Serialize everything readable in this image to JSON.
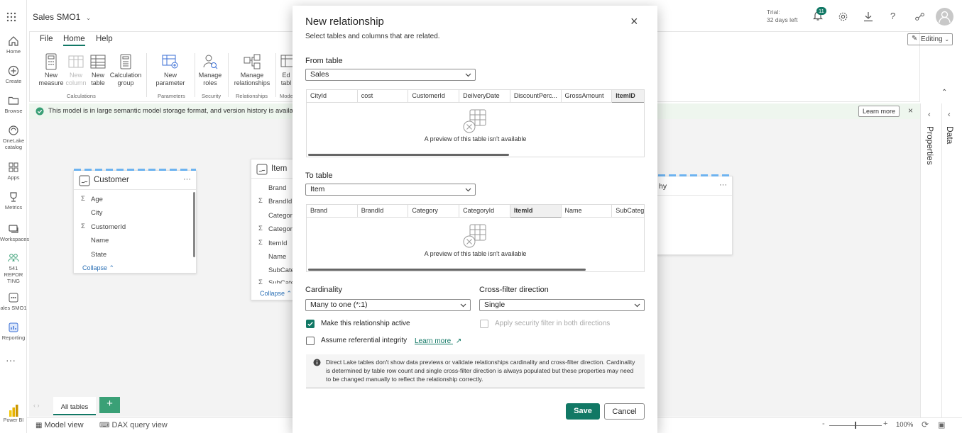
{
  "app": {
    "title": "Sales SMO1",
    "trial_line1": "Trial:",
    "trial_line2": "32 days left",
    "notification_count": "11",
    "editing_label": "Editing"
  },
  "rail": [
    {
      "label": "Home",
      "icon": "home-icon"
    },
    {
      "label": "Create",
      "icon": "plus-circle-icon"
    },
    {
      "label": "Browse",
      "icon": "folder-icon"
    },
    {
      "label": "OneLake catalog",
      "icon": "onelake-icon"
    },
    {
      "label": "Apps",
      "icon": "apps-icon"
    },
    {
      "label": "Metrics",
      "icon": "trophy-icon"
    },
    {
      "label": "Workspaces",
      "icon": "workspaces-icon"
    },
    {
      "label": "541 REPOR TING",
      "icon": "people-icon"
    },
    {
      "label": "ales SMO1",
      "icon": "semantic-model-icon"
    },
    {
      "label": "Reporting",
      "icon": "report-icon"
    }
  ],
  "ribbon": {
    "tabs": [
      "File",
      "Home",
      "Help"
    ],
    "active_tab": "Home",
    "buttons": {
      "new_measure": "New measure",
      "new_column": "New column",
      "new_table": "New table",
      "calc_group": "Calculation group",
      "new_parameter": "New parameter",
      "manage_roles": "Manage roles",
      "manage_relationships": "Manage relationships",
      "edit_tables": "Ed tabl"
    },
    "groups": {
      "calculations": "Calculations",
      "parameters": "Parameters",
      "security": "Security",
      "relationships": "Relationships",
      "model": "Mode"
    }
  },
  "infobar": {
    "message": "This model is in large semantic model storage format, and version history is available.",
    "learn_more": "Learn more"
  },
  "canvas": {
    "customer": {
      "title": "Customer",
      "fields": [
        {
          "name": "Age",
          "sigma": "Σ"
        },
        {
          "name": "City",
          "sigma": ""
        },
        {
          "name": "CustomerId",
          "sigma": "Σ"
        },
        {
          "name": "Name",
          "sigma": ""
        },
        {
          "name": "State",
          "sigma": ""
        }
      ],
      "collapse": "Collapse"
    },
    "item": {
      "title": "Item",
      "fields": [
        {
          "name": "Brand",
          "sigma": ""
        },
        {
          "name": "BrandId",
          "sigma": "Σ"
        },
        {
          "name": "Category",
          "sigma": ""
        },
        {
          "name": "CategoryId",
          "sigma": "Σ"
        },
        {
          "name": "ItemId",
          "sigma": "Σ"
        },
        {
          "name": "Name",
          "sigma": ""
        },
        {
          "name": "SubCateg",
          "sigma": ""
        },
        {
          "name": "SubCateg",
          "sigma": "Σ"
        }
      ],
      "collapse": "Collapse"
    },
    "geography": {
      "title": "hy"
    }
  },
  "bottom": {
    "tab": "All tables",
    "add": "+"
  },
  "status": {
    "model_view": "Model view",
    "dax_view": "DAX query view",
    "zoom": "100%",
    "zoom_minus": "-",
    "zoom_plus": "+"
  },
  "rightpane": {
    "properties": "Properties",
    "data": "Data"
  },
  "dialog": {
    "title": "New relationship",
    "subtitle": "Select tables and columns that are related.",
    "from_label": "From table",
    "from_value": "Sales",
    "from_columns": [
      "CityId",
      "cost",
      "CustomerId",
      "DeilveryDate",
      "DiscountPerc...",
      "GrossAmount",
      "ItemID"
    ],
    "from_selected": "ItemID",
    "preview_text": "A preview of this table isn't available",
    "to_label": "To table",
    "to_value": "Item",
    "to_columns": [
      "Brand",
      "BrandId",
      "Category",
      "CategoryId",
      "ItemId",
      "Name",
      "SubCateg"
    ],
    "to_selected": "ItemId",
    "cardinality_label": "Cardinality",
    "cardinality_value": "Many to one (*:1)",
    "crossfilter_label": "Cross-filter direction",
    "crossfilter_value": "Single",
    "active_label": "Make this relationship active",
    "active_checked": true,
    "security_label": "Apply security filter in both directions",
    "referential_label": "Assume referential integrity",
    "learn_more": "Learn more",
    "note": "Direct Lake tables don't show data previews or validate relationships cardinality and cross-filter direction. Cardinality is determined by table row count and single cross-filter direction is always populated but these properties may need to be changed manually to reflect the relationship correctly.",
    "save": "Save",
    "cancel": "Cancel",
    "accent": "#117865"
  }
}
